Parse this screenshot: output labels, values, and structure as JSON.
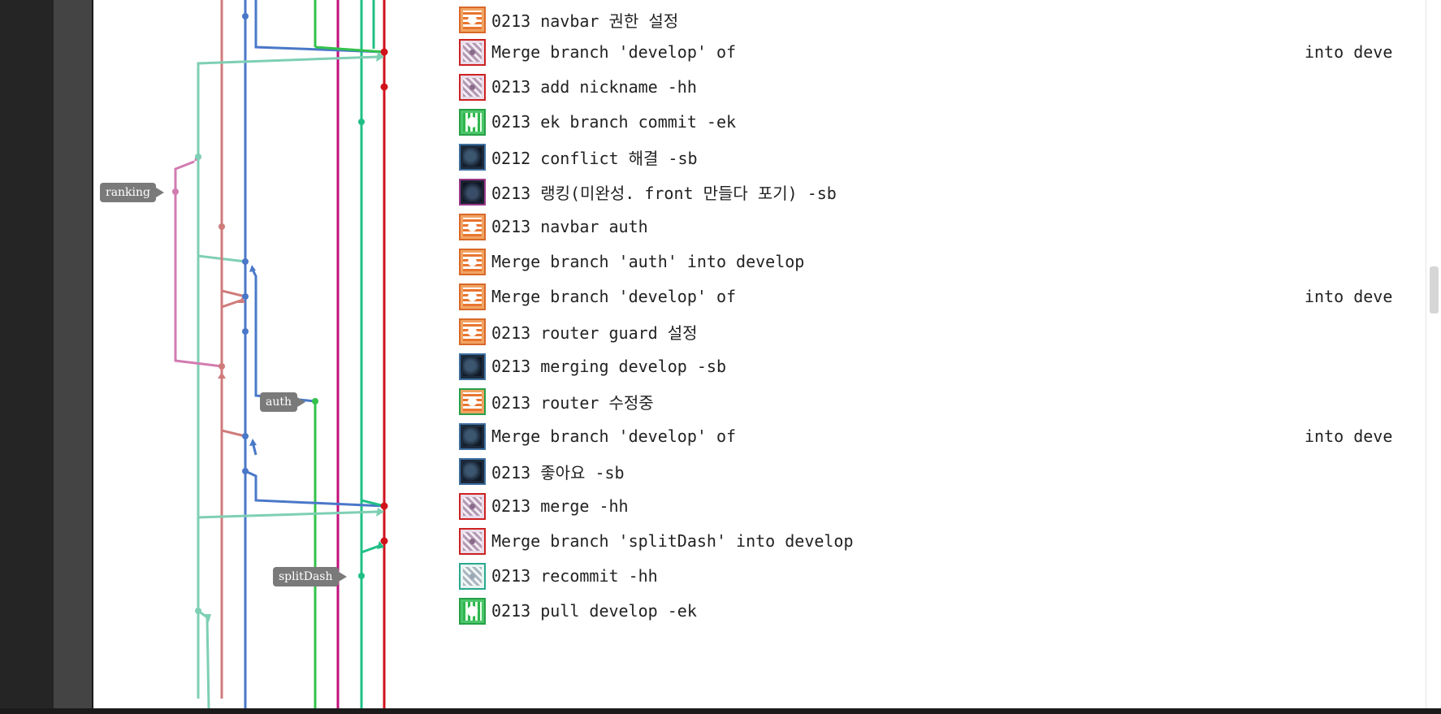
{
  "branch_labels": {
    "ranking": "ranking",
    "auth": "auth",
    "splitDash": "splitDash"
  },
  "commits": [
    {
      "avatar": "orange",
      "message": "0213 navbar 권한 설정",
      "right": ""
    },
    {
      "avatar": "purple",
      "message": "Merge branch 'develop' of",
      "right": "into deve"
    },
    {
      "avatar": "purple",
      "message": "0213 add nickname -hh",
      "right": ""
    },
    {
      "avatar": "green",
      "message": "0213 ek branch commit -ek",
      "right": ""
    },
    {
      "avatar": "dark",
      "message": "0212 conflict 해결 -sb",
      "right": ""
    },
    {
      "avatar": "darkp",
      "message": "0213 랭킹(미완성. front 만들다 포기) -sb",
      "right": ""
    },
    {
      "avatar": "orange",
      "message": "0213 navbar auth",
      "right": ""
    },
    {
      "avatar": "orange",
      "message": "Merge branch 'auth' into develop",
      "right": ""
    },
    {
      "avatar": "orange",
      "message": "Merge branch 'develop' of",
      "right": "into deve"
    },
    {
      "avatar": "orange",
      "message": "0213 router guard 설정",
      "right": ""
    },
    {
      "avatar": "dark",
      "message": "0213 merging develop -sb",
      "right": ""
    },
    {
      "avatar": "green-orange",
      "message": "0213 router 수정중",
      "right": ""
    },
    {
      "avatar": "dark",
      "message": "Merge branch 'develop' of",
      "right": "into deve"
    },
    {
      "avatar": "dark",
      "message": "0213 좋아요 -sb",
      "right": ""
    },
    {
      "avatar": "purple",
      "message": "0213 merge -hh",
      "right": ""
    },
    {
      "avatar": "purple",
      "message": "Merge branch 'splitDash' into develop",
      "right": ""
    },
    {
      "avatar": "teal",
      "message": "0213 recommit -hh",
      "right": ""
    },
    {
      "avatar": "green",
      "message": "0213 pull develop -ek",
      "right": ""
    }
  ],
  "colors": {
    "develop": "#d0121b",
    "blue": "#4a78c8",
    "teal": "#7ecfb3",
    "salmon": "#d07b7b",
    "pink": "#d27bb0",
    "magenta": "#c0107a",
    "green": "#33c24a",
    "seagreen": "#1fbf85"
  }
}
